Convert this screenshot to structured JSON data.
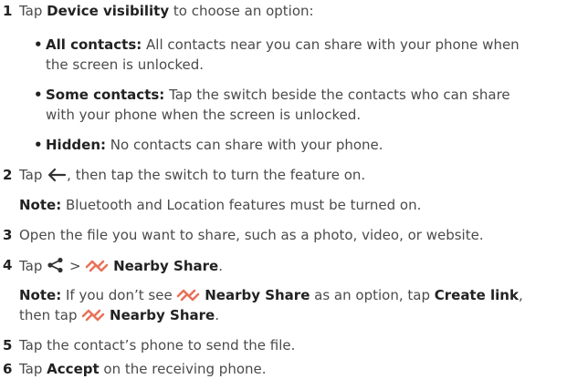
{
  "colors": {
    "text": "#4a4a4a",
    "bold": "#222222",
    "nearby_icon": "#e8735a",
    "icon_dark": "#333333"
  },
  "steps": [
    {
      "num": "1",
      "pre": "Tap ",
      "bold": "Device visibility",
      "post": " to choose an option:"
    },
    {
      "num": "2",
      "pre": "Tap ",
      "post": ", then tap the switch to turn the feature on.",
      "icon": "back-arrow-icon"
    },
    {
      "num": "3",
      "text": "Open the file you want to share, such as a photo, video, or website."
    },
    {
      "num": "4",
      "pre": "Tap ",
      "mid": " > ",
      "bold": "Nearby Share",
      "post": ".",
      "icons": [
        "share-icon",
        "nearby-share-icon"
      ]
    },
    {
      "num": "5",
      "text": "Tap the contact’s phone to send the file."
    },
    {
      "num": "6",
      "pre": "Tap ",
      "bold": "Accept",
      "post": " on the receiving phone."
    }
  ],
  "bullets": [
    {
      "bullet": "•",
      "bold": "All contacts:",
      "line1": " All contacts near you can share with your phone when",
      "line2": "the screen is unlocked."
    },
    {
      "bullet": "•",
      "bold": "Some contacts:",
      "line1": " Tap the switch beside the contacts who can share",
      "line2": "with your phone when the screen is unlocked."
    },
    {
      "bullet": "•",
      "bold": "Hidden:",
      "line1": " No contacts can share with your phone."
    }
  ],
  "notes": {
    "note1": {
      "label": "Note:",
      "text": " Bluetooth and Location features must be turned on."
    },
    "note2": {
      "label": "Note:",
      "pre": " If you don’t see ",
      "bold1": "Nearby Share",
      "mid": " as an option, tap ",
      "bold2": "Create link",
      "post1": ",",
      "line2_pre": "then tap ",
      "bold3": "Nearby Share",
      "line2_post": "."
    }
  }
}
